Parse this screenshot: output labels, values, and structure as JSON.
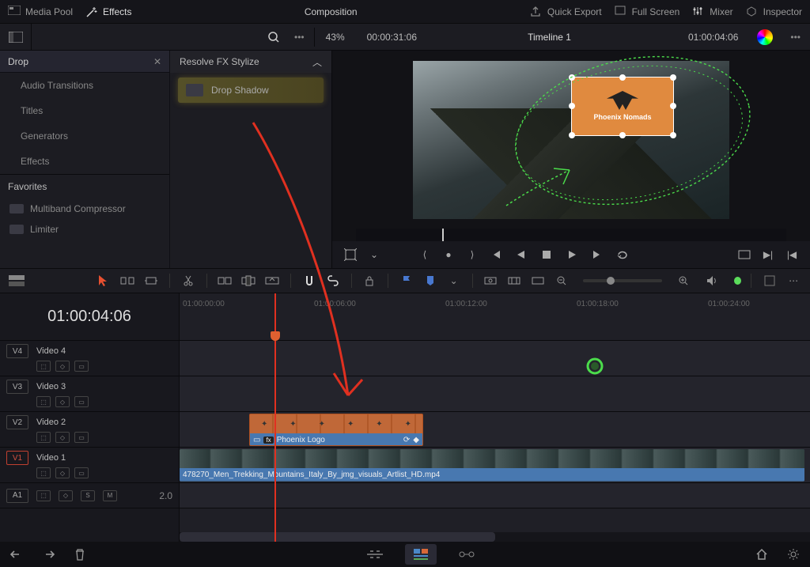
{
  "topbar": {
    "media_pool": "Media Pool",
    "effects": "Effects",
    "composition": "Composition",
    "quick_export": "Quick Export",
    "full_screen": "Full Screen",
    "mixer": "Mixer",
    "inspector": "Inspector"
  },
  "secondbar": {
    "zoom_pct": "43%",
    "source_tc": "00:00:31:06",
    "timeline_name": "Timeline 1",
    "record_tc": "01:00:04:06"
  },
  "effects_panel": {
    "search_value": "Drop",
    "categories": [
      "Audio Transitions",
      "Titles",
      "Generators",
      "Effects"
    ],
    "favorites_header": "Favorites",
    "favorites": [
      "Multiband Compressor",
      "Limiter"
    ],
    "group_header": "Resolve FX Stylize",
    "fx_item": "Drop Shadow"
  },
  "viewer": {
    "logo_text": "Phoenix Nomads"
  },
  "timeline": {
    "timecode": "01:00:04:06",
    "ruler_ticks": [
      "01:00:00:00",
      "01:00:06:00",
      "01:00:12:00",
      "01:00:18:00",
      "01:00:24:00"
    ],
    "tracks": {
      "v4": {
        "tag": "V4",
        "name": "Video 4"
      },
      "v3": {
        "tag": "V3",
        "name": "Video 3"
      },
      "v2": {
        "tag": "V2",
        "name": "Video 2"
      },
      "v1": {
        "tag": "V1",
        "name": "Video 1"
      },
      "a1": {
        "tag": "A1",
        "s": "S",
        "m": "M",
        "level": "2.0"
      }
    },
    "clips": {
      "v2_label": "Phoenix Logo",
      "v2_fx": "fx",
      "v1_label": "478270_Men_Trekking_Mountains_Italy_By_jmg_visuals_Artlist_HD.mp4"
    }
  }
}
